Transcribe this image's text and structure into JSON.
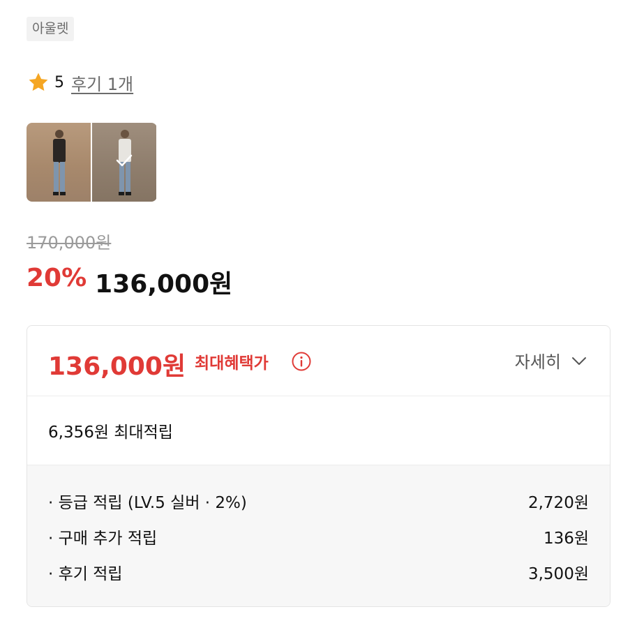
{
  "tag": "아울렛",
  "rating": {
    "score": "5",
    "reviews": "후기 1개"
  },
  "thumbnails": [
    {
      "icon": "photo",
      "selected": false
    },
    {
      "icon": "photo",
      "selected": true
    }
  ],
  "price": {
    "original": "170,000원",
    "discount": "20%",
    "final": "136,000원"
  },
  "benefit_card": {
    "max_price": "136,000원",
    "max_label": "최대혜택가",
    "details_label": "자세히",
    "points_text": "6,356원 최대적립",
    "items": [
      {
        "label": "등급 적립 (LV.5 실버 · 2%)",
        "value": "2,720원"
      },
      {
        "label": "구매 추가 적립",
        "value": "136원"
      },
      {
        "label": "후기 적립",
        "value": "3,500원"
      }
    ]
  },
  "colors": {
    "accent": "#e03a36",
    "star": "#f5a623",
    "muted": "#9a9a9a"
  }
}
